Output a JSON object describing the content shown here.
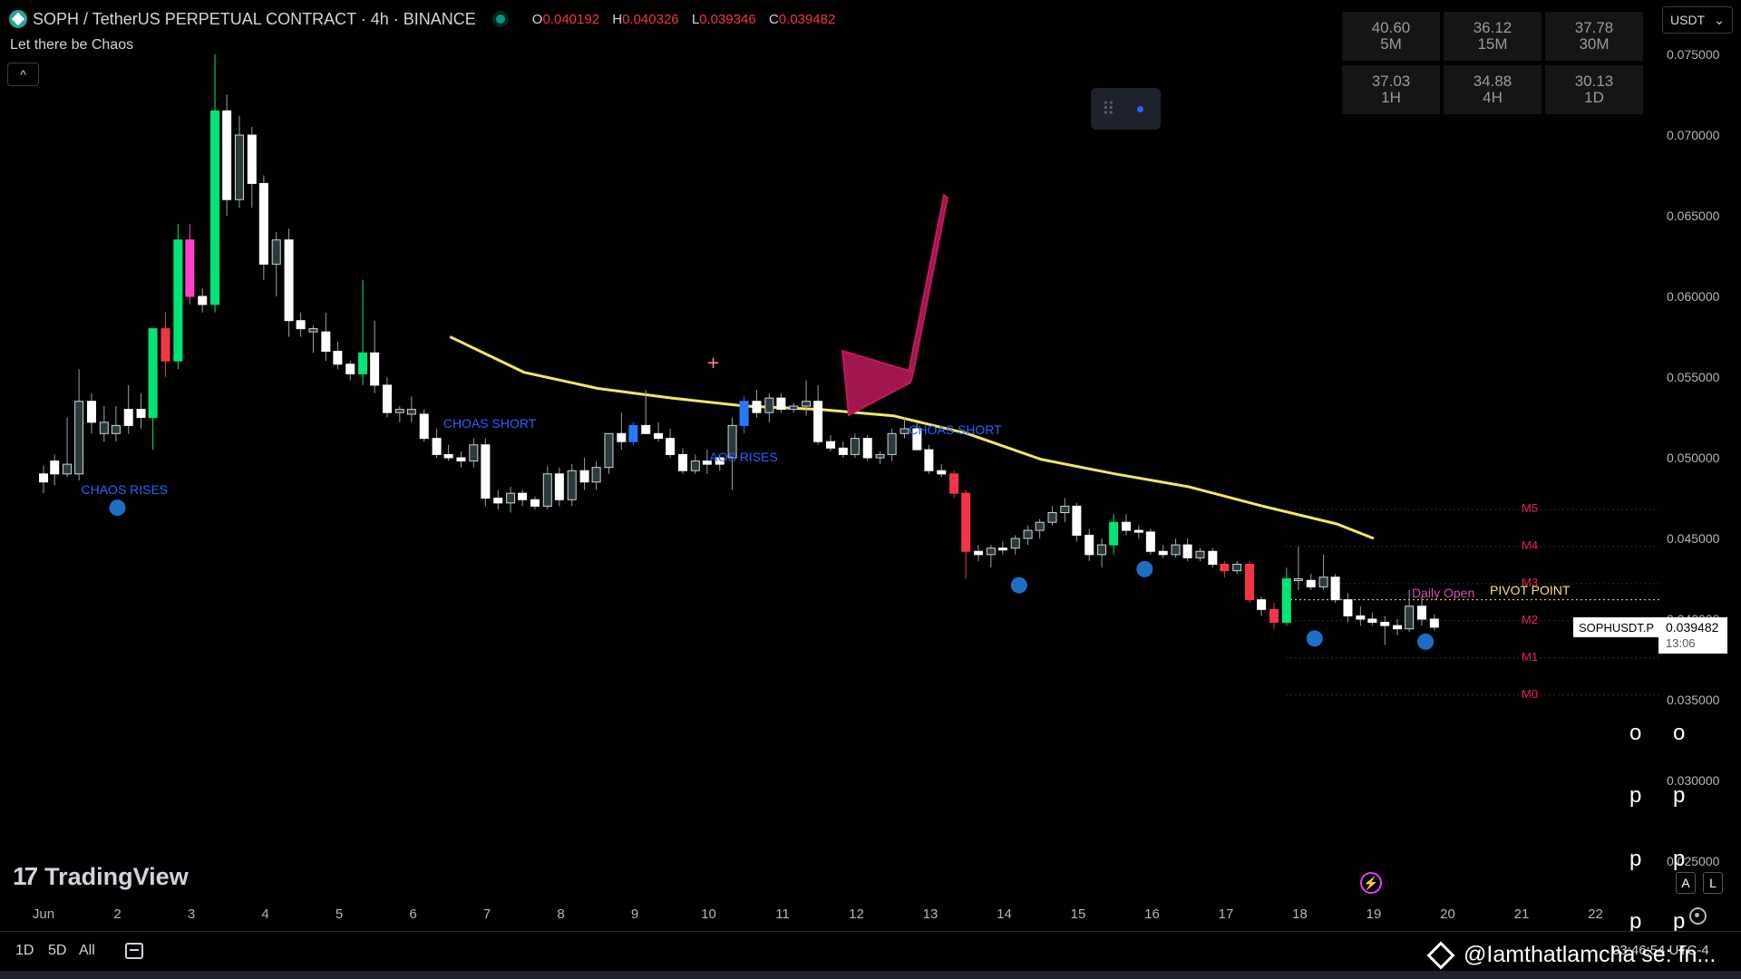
{
  "header": {
    "title": "SOPH / TetherUS PERPETUAL CONTRACT · 4h · BINANCE",
    "ohlc": {
      "o_label": "O",
      "o": "0.040192",
      "h_label": "H",
      "h": "0.040326",
      "l_label": "L",
      "l": "0.039346",
      "c_label": "C",
      "c": "0.039482"
    },
    "indicator": "Let there be Chaos",
    "collapse_glyph": "^"
  },
  "currency": "USDT",
  "rsi_table": [
    {
      "value": "40.60",
      "tf": "5M"
    },
    {
      "value": "36.12",
      "tf": "15M"
    },
    {
      "value": "37.78",
      "tf": "30M"
    },
    {
      "value": "37.03",
      "tf": "1H"
    },
    {
      "value": "34.88",
      "tf": "4H"
    },
    {
      "value": "30.13",
      "tf": "1D"
    }
  ],
  "price_axis": [
    "0.075000",
    "0.070000",
    "0.065000",
    "0.060000",
    "0.055000",
    "0.050000",
    "0.045000",
    "0.040000",
    "0.035000",
    "0.030000",
    "0.025000"
  ],
  "current": {
    "ticker": "SOPHUSDT.P",
    "price": "0.039482",
    "countdown": "13:06"
  },
  "x_labels": [
    "Jun",
    "2",
    "3",
    "4",
    "5",
    "6",
    "7",
    "8",
    "9",
    "10",
    "11",
    "12",
    "13",
    "14",
    "15",
    "16",
    "17",
    "18",
    "19",
    "20",
    "21",
    "22"
  ],
  "levels": [
    {
      "name": "M5",
      "price": 0.0468
    },
    {
      "name": "M4",
      "price": 0.0445
    },
    {
      "name": "M3",
      "price": 0.0422
    },
    {
      "name": "M2",
      "price": 0.0399
    },
    {
      "name": "M1",
      "price": 0.0376
    },
    {
      "name": "M0",
      "price": 0.0353
    }
  ],
  "pivot": {
    "daily_open": "Daily Open",
    "pivot_point": "PIVOT POINT",
    "price": 0.0412
  },
  "signals": [
    {
      "text": "CHAOS RISES",
      "day": 1.0,
      "price": 0.048
    },
    {
      "text": "CHOAS SHORT",
      "day": 5.9,
      "price": 0.0521
    },
    {
      "text": "AOS RISES",
      "day": 9.5,
      "price": 0.05
    },
    {
      "text": "CHOAS SHORT",
      "day": 12.2,
      "price": 0.0517
    }
  ],
  "range_buttons": [
    "1D",
    "5D",
    "All"
  ],
  "brand": "TradingView",
  "watermark": "@Iamthatlamcha  se: fn...",
  "clock": "03:46:54 UTC-4",
  "side_glyphs": [
    "o",
    "o",
    "p",
    "p",
    "p",
    "p",
    "p",
    "p"
  ],
  "al_buttons": [
    "A",
    "L"
  ],
  "colors": {
    "up": "#00e676",
    "down": "#f23645",
    "ema": "#f5e663",
    "arrow": "#a0174f",
    "dot": "#1e6fc4",
    "signal": "#2962ff"
  },
  "chart_data": {
    "type": "candlestick",
    "x_axis": "days in June",
    "y_range": [
      0.022,
      0.078
    ],
    "ema": [
      [
        5.5,
        0.0575
      ],
      [
        6.5,
        0.0553
      ],
      [
        7.5,
        0.0543
      ],
      [
        8.5,
        0.0537
      ],
      [
        9.5,
        0.0532
      ],
      [
        10.5,
        0.053
      ],
      [
        11.5,
        0.0526
      ],
      [
        12.5,
        0.0515
      ],
      [
        13.5,
        0.0499
      ],
      [
        14.5,
        0.049
      ],
      [
        15.5,
        0.0482
      ],
      [
        16.5,
        0.047
      ],
      [
        17.5,
        0.0459
      ],
      [
        18.0,
        0.045
      ]
    ],
    "dots": [
      [
        1.0,
        0.0469
      ],
      [
        13.2,
        0.0421
      ],
      [
        14.9,
        0.0431
      ],
      [
        17.2,
        0.0388
      ],
      [
        18.7,
        0.0386
      ]
    ],
    "candles": [
      [
        0.0,
        0.0485,
        0.0495,
        0.0478,
        0.049,
        "w"
      ],
      [
        0.15,
        0.049,
        0.0502,
        0.0483,
        0.0498,
        "w"
      ],
      [
        0.32,
        0.0496,
        0.0525,
        0.0488,
        0.049,
        "k"
      ],
      [
        0.48,
        0.049,
        0.0555,
        0.0486,
        0.0535,
        "k"
      ],
      [
        0.65,
        0.0535,
        0.054,
        0.0515,
        0.0522,
        "w"
      ],
      [
        0.82,
        0.0522,
        0.0532,
        0.051,
        0.0515,
        "k"
      ],
      [
        0.98,
        0.0515,
        0.0532,
        0.051,
        0.052,
        "k"
      ],
      [
        1.15,
        0.052,
        0.0545,
        0.0515,
        0.053,
        "w"
      ],
      [
        1.32,
        0.053,
        0.054,
        0.0518,
        0.0525,
        "w"
      ],
      [
        1.48,
        0.0525,
        0.055,
        0.0505,
        0.058,
        "g"
      ],
      [
        1.65,
        0.058,
        0.059,
        0.055,
        0.056,
        "r"
      ],
      [
        1.82,
        0.056,
        0.0645,
        0.0555,
        0.0635,
        "g"
      ],
      [
        1.98,
        0.0635,
        0.0645,
        0.0595,
        0.06,
        "m"
      ],
      [
        2.15,
        0.06,
        0.0605,
        0.059,
        0.0595,
        "w"
      ],
      [
        2.32,
        0.0595,
        0.075,
        0.059,
        0.0715,
        "g"
      ],
      [
        2.48,
        0.0715,
        0.0725,
        0.065,
        0.066,
        "w"
      ],
      [
        2.65,
        0.066,
        0.0712,
        0.0655,
        0.07,
        "k"
      ],
      [
        2.82,
        0.07,
        0.0705,
        0.0655,
        0.067,
        "w"
      ],
      [
        2.98,
        0.067,
        0.0675,
        0.061,
        0.062,
        "w"
      ],
      [
        3.15,
        0.062,
        0.064,
        0.06,
        0.0635,
        "k"
      ],
      [
        3.32,
        0.0635,
        0.0642,
        0.0575,
        0.0585,
        "w"
      ],
      [
        3.48,
        0.0585,
        0.059,
        0.0575,
        0.058,
        "w"
      ],
      [
        3.65,
        0.058,
        0.0582,
        0.0565,
        0.0578,
        "k"
      ],
      [
        3.82,
        0.0578,
        0.059,
        0.056,
        0.0566,
        "w"
      ],
      [
        3.98,
        0.0566,
        0.0572,
        0.0555,
        0.0558,
        "w"
      ],
      [
        4.15,
        0.0558,
        0.056,
        0.0548,
        0.0552,
        "w"
      ],
      [
        4.32,
        0.0552,
        0.061,
        0.0545,
        0.0565,
        "g"
      ],
      [
        4.48,
        0.0565,
        0.0585,
        0.054,
        0.0545,
        "w"
      ],
      [
        4.65,
        0.0545,
        0.055,
        0.0525,
        0.0528,
        "w"
      ],
      [
        4.82,
        0.0528,
        0.0532,
        0.0522,
        0.053,
        "k"
      ],
      [
        4.98,
        0.053,
        0.0538,
        0.0522,
        0.0527,
        "k"
      ],
      [
        5.15,
        0.0527,
        0.053,
        0.051,
        0.0512,
        "w"
      ],
      [
        5.32,
        0.0512,
        0.0518,
        0.05,
        0.0502,
        "w"
      ],
      [
        5.48,
        0.0502,
        0.0508,
        0.0498,
        0.05,
        "w"
      ],
      [
        5.65,
        0.05,
        0.0504,
        0.0494,
        0.0498,
        "w"
      ],
      [
        5.82,
        0.0498,
        0.0512,
        0.0494,
        0.0508,
        "k"
      ],
      [
        5.98,
        0.0508,
        0.0512,
        0.047,
        0.0475,
        "w"
      ],
      [
        6.15,
        0.0475,
        0.048,
        0.0468,
        0.0472,
        "w"
      ],
      [
        6.32,
        0.0472,
        0.0482,
        0.0466,
        0.0478,
        "k"
      ],
      [
        6.48,
        0.0478,
        0.048,
        0.047,
        0.0474,
        "w"
      ],
      [
        6.65,
        0.0474,
        0.0476,
        0.0468,
        0.047,
        "w"
      ],
      [
        6.82,
        0.047,
        0.0495,
        0.0468,
        0.049,
        "k"
      ],
      [
        6.98,
        0.049,
        0.0494,
        0.047,
        0.0474,
        "w"
      ],
      [
        7.15,
        0.0474,
        0.0496,
        0.047,
        0.0492,
        "k"
      ],
      [
        7.32,
        0.0492,
        0.05,
        0.048,
        0.0485,
        "w"
      ],
      [
        7.48,
        0.0485,
        0.0498,
        0.048,
        0.0494,
        "k"
      ],
      [
        7.65,
        0.0494,
        0.0515,
        0.049,
        0.0515,
        "k"
      ],
      [
        7.82,
        0.0515,
        0.0528,
        0.0505,
        0.051,
        "w"
      ],
      [
        7.98,
        0.051,
        0.0522,
        0.0508,
        0.052,
        "b"
      ],
      [
        8.15,
        0.052,
        0.0542,
        0.0515,
        0.0515,
        "w"
      ],
      [
        8.32,
        0.0515,
        0.0522,
        0.051,
        0.0512,
        "w"
      ],
      [
        8.48,
        0.0512,
        0.0518,
        0.05,
        0.0502,
        "w"
      ],
      [
        8.65,
        0.0502,
        0.0506,
        0.049,
        0.0492,
        "w"
      ],
      [
        8.82,
        0.0492,
        0.0502,
        0.049,
        0.0498,
        "k"
      ],
      [
        8.98,
        0.0498,
        0.0505,
        0.049,
        0.0496,
        "w"
      ],
      [
        9.15,
        0.0496,
        0.0502,
        0.0492,
        0.05,
        "w"
      ],
      [
        9.32,
        0.05,
        0.0525,
        0.048,
        0.052,
        "k"
      ],
      [
        9.48,
        0.052,
        0.0538,
        0.0515,
        0.0535,
        "b"
      ],
      [
        9.65,
        0.0535,
        0.0542,
        0.0525,
        0.0528,
        "w"
      ],
      [
        9.82,
        0.0528,
        0.054,
        0.0522,
        0.0537,
        "k"
      ],
      [
        9.98,
        0.0537,
        0.054,
        0.0528,
        0.053,
        "w"
      ],
      [
        10.15,
        0.053,
        0.0534,
        0.0528,
        0.0532,
        "k"
      ],
      [
        10.32,
        0.0532,
        0.0548,
        0.0526,
        0.0535,
        "k"
      ],
      [
        10.48,
        0.0535,
        0.0545,
        0.0508,
        0.051,
        "w"
      ],
      [
        10.65,
        0.051,
        0.0514,
        0.0504,
        0.0506,
        "w"
      ],
      [
        10.82,
        0.0506,
        0.051,
        0.05,
        0.0502,
        "w"
      ],
      [
        10.98,
        0.0502,
        0.0515,
        0.05,
        0.0512,
        "k"
      ],
      [
        11.15,
        0.0512,
        0.0514,
        0.0498,
        0.05,
        "w"
      ],
      [
        11.32,
        0.05,
        0.0504,
        0.0496,
        0.0502,
        "k"
      ],
      [
        11.48,
        0.0502,
        0.0518,
        0.0498,
        0.0515,
        "k"
      ],
      [
        11.65,
        0.0515,
        0.0525,
        0.0512,
        0.0518,
        "k"
      ],
      [
        11.82,
        0.0518,
        0.0522,
        0.0505,
        0.0505,
        "w"
      ],
      [
        11.98,
        0.0505,
        0.0508,
        0.049,
        0.0492,
        "w"
      ],
      [
        12.15,
        0.0492,
        0.0496,
        0.0488,
        0.049,
        "w"
      ],
      [
        12.32,
        0.049,
        0.0492,
        0.0475,
        0.0478,
        "r"
      ],
      [
        12.48,
        0.0478,
        0.048,
        0.0425,
        0.0442,
        "r"
      ],
      [
        12.65,
        0.0442,
        0.0446,
        0.0436,
        0.044,
        "w"
      ],
      [
        12.82,
        0.044,
        0.0446,
        0.0432,
        0.0444,
        "k"
      ],
      [
        12.98,
        0.0444,
        0.0448,
        0.044,
        0.0444,
        "w"
      ],
      [
        13.15,
        0.0444,
        0.0452,
        0.044,
        0.045,
        "k"
      ],
      [
        13.32,
        0.045,
        0.0458,
        0.0446,
        0.0455,
        "k"
      ],
      [
        13.48,
        0.0455,
        0.0462,
        0.045,
        0.046,
        "k"
      ],
      [
        13.65,
        0.046,
        0.047,
        0.0458,
        0.0466,
        "k"
      ],
      [
        13.82,
        0.0466,
        0.0475,
        0.046,
        0.047,
        "k"
      ],
      [
        13.98,
        0.047,
        0.0472,
        0.0448,
        0.0452,
        "w"
      ],
      [
        14.15,
        0.0452,
        0.0456,
        0.0436,
        0.044,
        "w"
      ],
      [
        14.32,
        0.044,
        0.045,
        0.0432,
        0.0446,
        "k"
      ],
      [
        14.48,
        0.0446,
        0.0465,
        0.044,
        0.046,
        "g"
      ],
      [
        14.65,
        0.046,
        0.0465,
        0.0452,
        0.0455,
        "w"
      ],
      [
        14.82,
        0.0455,
        0.0458,
        0.045,
        0.0454,
        "w"
      ],
      [
        14.98,
        0.0454,
        0.0456,
        0.044,
        0.0442,
        "w"
      ],
      [
        15.15,
        0.0442,
        0.0446,
        0.0438,
        0.044,
        "w"
      ],
      [
        15.32,
        0.044,
        0.045,
        0.0438,
        0.0446,
        "k"
      ],
      [
        15.48,
        0.0446,
        0.045,
        0.0436,
        0.0438,
        "w"
      ],
      [
        15.65,
        0.0438,
        0.0444,
        0.0436,
        0.0442,
        "k"
      ],
      [
        15.82,
        0.0442,
        0.0444,
        0.0432,
        0.0434,
        "w"
      ],
      [
        15.98,
        0.0434,
        0.0436,
        0.0426,
        0.043,
        "r"
      ],
      [
        16.15,
        0.043,
        0.0436,
        0.0428,
        0.0434,
        "k"
      ],
      [
        16.32,
        0.0434,
        0.0436,
        0.041,
        0.0412,
        "r"
      ],
      [
        16.48,
        0.0412,
        0.0414,
        0.0402,
        0.0406,
        "w"
      ],
      [
        16.65,
        0.0406,
        0.041,
        0.0394,
        0.0398,
        "r"
      ],
      [
        16.82,
        0.0398,
        0.0432,
        0.0396,
        0.0425,
        "g"
      ],
      [
        16.98,
        0.0425,
        0.0445,
        0.0418,
        0.0424,
        "k"
      ],
      [
        17.15,
        0.0424,
        0.0428,
        0.0418,
        0.042,
        "w"
      ],
      [
        17.32,
        0.042,
        0.044,
        0.0418,
        0.0426,
        "k"
      ],
      [
        17.48,
        0.0426,
        0.0428,
        0.041,
        0.0412,
        "w"
      ],
      [
        17.65,
        0.0412,
        0.0416,
        0.0398,
        0.0402,
        "w"
      ],
      [
        17.82,
        0.0402,
        0.0408,
        0.0396,
        0.04,
        "w"
      ],
      [
        17.98,
        0.04,
        0.0404,
        0.0396,
        0.0398,
        "w"
      ],
      [
        18.15,
        0.0398,
        0.0402,
        0.0384,
        0.0396,
        "w"
      ],
      [
        18.32,
        0.0396,
        0.04,
        0.039,
        0.0394,
        "w"
      ],
      [
        18.48,
        0.0394,
        0.0418,
        0.0392,
        0.0408,
        "k"
      ],
      [
        18.65,
        0.0408,
        0.0414,
        0.0396,
        0.04,
        "w"
      ],
      [
        18.82,
        0.04,
        0.0403,
        0.0393,
        0.0395,
        "w"
      ]
    ]
  }
}
